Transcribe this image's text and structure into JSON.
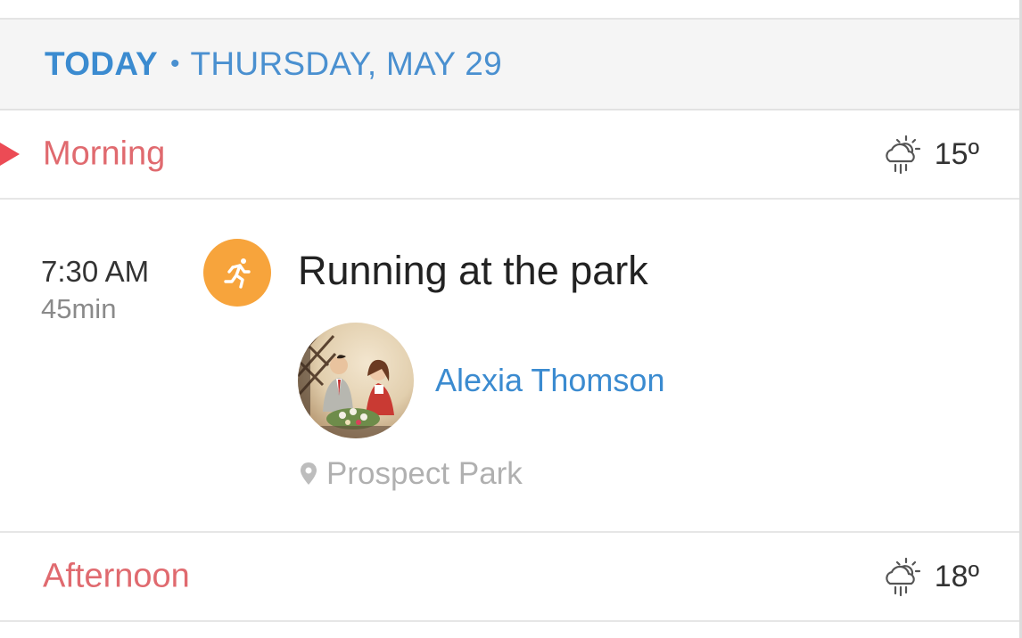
{
  "header": {
    "today_label": "TODAY",
    "separator": "•",
    "date": "THURSDAY, MAY 29"
  },
  "periods": [
    {
      "label": "Morning",
      "weather_icon": "cloud-rain-sun-icon",
      "temperature": "15º",
      "current": true
    },
    {
      "label": "Afternoon",
      "weather_icon": "cloud-rain-sun-icon",
      "temperature": "18º",
      "current": false
    }
  ],
  "event": {
    "time": "7:30 AM",
    "duration": "45min",
    "type_icon": "running-icon",
    "title": "Running at the park",
    "attendee": {
      "name": "Alexia Thomson",
      "avatar": "avatar-photo"
    },
    "location_icon": "map-pin-icon",
    "location": "Prospect Park"
  },
  "colors": {
    "accent_blue": "#3b8bd0",
    "period_red": "#e06a6f",
    "now_marker": "#ec4b55",
    "event_orange": "#f7a43c",
    "muted_gray": "#b0b0b0"
  }
}
